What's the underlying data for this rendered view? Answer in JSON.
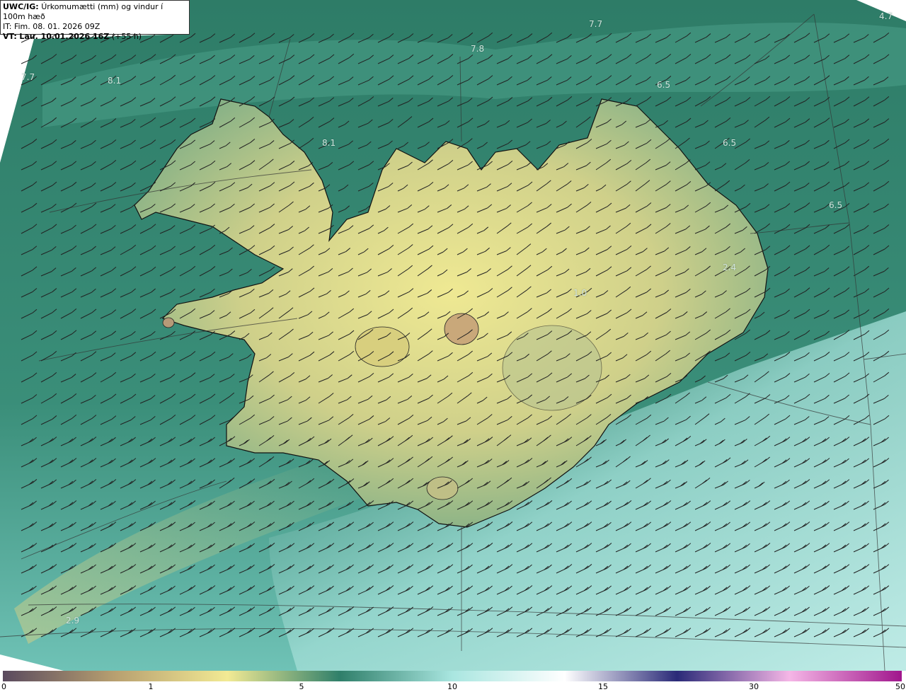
{
  "header": {
    "model_label": "UWC/IG:",
    "title": "Úrkomumætti (mm) og vindur í 100m hæð",
    "issue_time": "IT: Fim. 08. 01. 2026 09Z",
    "valid_prefix": "VT:",
    "valid_time": "Lau. 10.01.2026 16Z",
    "lead_time": "(+55 h)"
  },
  "field_labels": [
    {
      "text": "7.7"
    },
    {
      "text": "7.8"
    },
    {
      "text": "4.7"
    },
    {
      "text": "7.7"
    },
    {
      "text": "8.1"
    },
    {
      "text": "6.5"
    },
    {
      "text": "8.1"
    },
    {
      "text": "6.5"
    },
    {
      "text": "6.5"
    },
    {
      "text": "2.4"
    },
    {
      "text": "1.0"
    },
    {
      "text": "2.9"
    }
  ],
  "colorbar": {
    "ticks": [
      "0",
      "1",
      "5",
      "10",
      "15",
      "30",
      "50"
    ],
    "tick_values": [
      0,
      1,
      5,
      10,
      15,
      30,
      50
    ],
    "colors": [
      "#5a4a5e",
      "#b8a070",
      "#f2ea94",
      "#2f7f6a",
      "#a9e6e0",
      "#ffffff",
      "#2a2a78",
      "#f5b6e6",
      "#a0168c"
    ]
  },
  "palette": {
    "sea": "#2e7c67",
    "land_low": "#c8cc86",
    "land_high": "#ece88c",
    "precip": "#8fd6cf",
    "coast": "#111111",
    "grid": "#333333"
  }
}
